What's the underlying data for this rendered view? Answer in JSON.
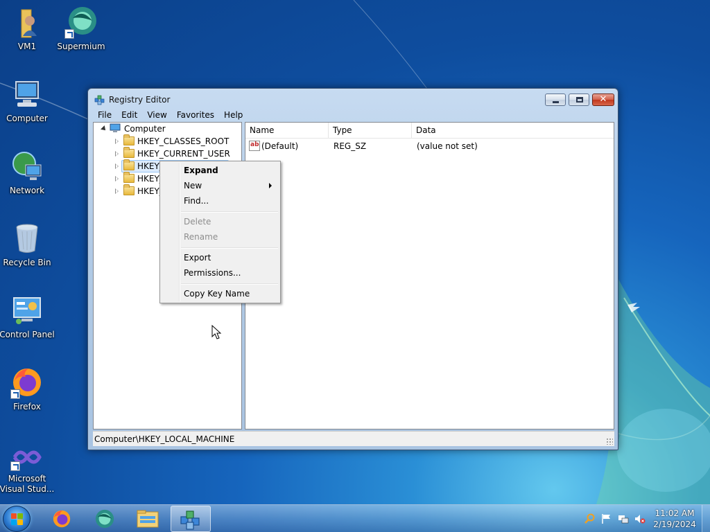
{
  "desktop": {
    "icons": [
      {
        "label": "VM1",
        "icon": "user-folder-icon"
      },
      {
        "label": "Supermium",
        "icon": "supermium-icon"
      },
      {
        "label": "Computer",
        "icon": "computer-icon"
      },
      {
        "label": "Network",
        "icon": "network-icon"
      },
      {
        "label": "Recycle Bin",
        "icon": "recycle-bin-icon"
      },
      {
        "label": "Control Panel",
        "icon": "control-panel-icon"
      },
      {
        "label": "Firefox",
        "icon": "firefox-icon"
      },
      {
        "label": "Microsoft Visual Stud...",
        "label_line1": "Microsoft",
        "label_line2": "Visual Stud...",
        "icon": "visual-studio-icon"
      }
    ]
  },
  "window": {
    "title": "Registry Editor",
    "menu": [
      "File",
      "Edit",
      "View",
      "Favorites",
      "Help"
    ],
    "tree": {
      "root": "Computer",
      "children": [
        "HKEY_CLASSES_ROOT",
        "HKEY_CURRENT_USER",
        "HKEY_",
        "HKEY_",
        "HKEY_"
      ],
      "selected_index": 2
    },
    "list": {
      "columns": [
        "Name",
        "Type",
        "Data"
      ],
      "rows": [
        {
          "name": "(Default)",
          "type": "REG_SZ",
          "data": "(value not set)"
        }
      ]
    },
    "status": "Computer\\HKEY_LOCAL_MACHINE"
  },
  "context_menu": {
    "items": [
      {
        "label": "Expand",
        "bold": true,
        "disabled": false
      },
      {
        "label": "New",
        "submenu": true,
        "disabled": false
      },
      {
        "label": "Find...",
        "disabled": false
      },
      {
        "label": "Delete",
        "disabled": true
      },
      {
        "label": "Rename",
        "disabled": true
      },
      {
        "label": "Export",
        "disabled": false
      },
      {
        "label": "Permissions...",
        "disabled": false
      },
      {
        "label": "Copy Key Name",
        "disabled": false
      }
    ]
  },
  "taskbar": {
    "pinned": [
      "start-orb",
      "firefox-icon",
      "supermium-icon",
      "file-explorer-icon",
      "registry-editor-icon"
    ],
    "active": "registry-editor-icon",
    "tray": [
      "search-icon",
      "action-center-flag-icon",
      "network-icon",
      "volume-muted-icon"
    ],
    "time": "11:02 AM",
    "date": "2/19/2024"
  },
  "colors": {
    "desktop_bg": "#1665bd",
    "selection": "#dcebfc",
    "close_button": "#c0371d"
  }
}
